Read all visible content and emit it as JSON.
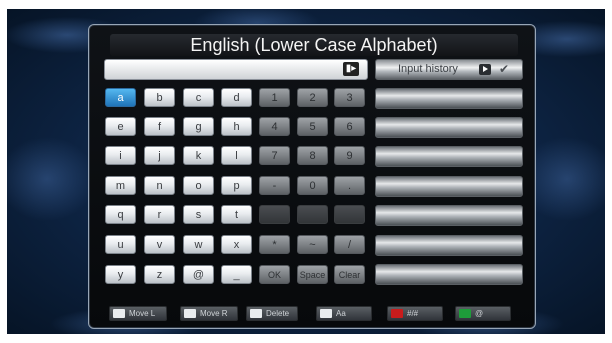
{
  "title": "English (Lower Case Alphabet)",
  "input": {
    "value": ""
  },
  "letters": [
    [
      "a",
      "b",
      "c",
      "d"
    ],
    [
      "e",
      "f",
      "g",
      "h"
    ],
    [
      "i",
      "j",
      "k",
      "l"
    ],
    [
      "m",
      "n",
      "o",
      "p"
    ],
    [
      "q",
      "r",
      "s",
      "t"
    ],
    [
      "u",
      "v",
      "w",
      "x"
    ],
    [
      "y",
      "z",
      "@",
      "_"
    ]
  ],
  "digits": [
    [
      "1",
      "2",
      "3"
    ],
    [
      "4",
      "5",
      "6"
    ],
    [
      "7",
      "8",
      "9"
    ],
    [
      "-",
      "0",
      "."
    ],
    [
      "",
      "",
      ""
    ],
    [
      "*",
      "~",
      "/"
    ],
    [
      "OK",
      "Space",
      "Clear"
    ]
  ],
  "selected_key": "a",
  "history": {
    "label": "Input history",
    "rows": [
      "",
      "",
      "",
      "",
      "",
      "",
      ""
    ]
  },
  "footer": [
    {
      "label": "Move L",
      "icon": "left-arrow-key-icon"
    },
    {
      "label": "Move R",
      "icon": "right-arrow-key-icon"
    },
    {
      "label": "Delete",
      "icon": "delete-key-icon"
    },
    {
      "label": "Aa",
      "icon": "search-key-icon"
    },
    {
      "label": "#/#",
      "icon": "red-key-icon"
    },
    {
      "label": "@",
      "icon": "green-key-icon"
    }
  ],
  "colors": {
    "selected": "#1f74b8",
    "red": "#c81c1c",
    "green": "#1e9c3a"
  }
}
